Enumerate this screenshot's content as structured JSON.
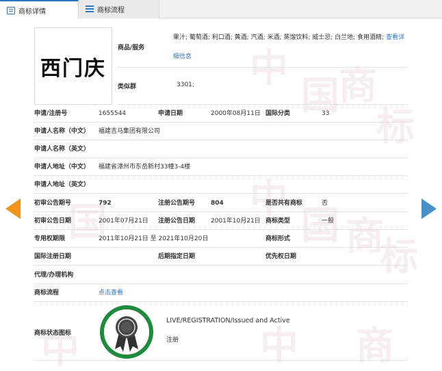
{
  "tabs": [
    {
      "label": "商标详情",
      "icon": "document-icon",
      "active": true
    },
    {
      "label": "商标流程",
      "icon": "list-icon",
      "active": false
    }
  ],
  "trademark": {
    "logo_text": "西门庆",
    "goods_label": "商品/服务",
    "goods_value": "果汁; 葡萄酒; 利口酒; 黄酒; 汽酒; 米酒; 蒸馏饮料; 威士忌; 白兰地; 食用酒精;",
    "goods_more_line1": "查看详",
    "goods_more_line2": "细信息",
    "similar_group_label": "类似群",
    "similar_group_value": "3301;",
    "reg_no_label": "申请/注册号",
    "reg_no_value": "1655544",
    "apply_date_label": "申请日期",
    "apply_date_value": "2000年08月11日",
    "intl_class_label": "国际分类",
    "intl_class_value": "33",
    "applicant_cn_label": "申请人名称（中文）",
    "applicant_cn_value": "福建吉马集团有限公司",
    "applicant_en_label": "申请人名称（英文）",
    "address_cn_label": "申请人地址（中文）",
    "address_cn_value": "福建省漳州市东岳新村33幢3-4楼",
    "address_en_label": "申请人地址（英文）",
    "prelim_no_label": "初审公告期号",
    "prelim_no_value": "792",
    "reg_pub_no_label": "注册公告期号",
    "reg_pub_no_value": "804",
    "shared_label": "是否共有商标",
    "shared_value": "否",
    "prelim_date_label": "初审公告日期",
    "prelim_date_value": "2001年07月21日",
    "reg_pub_date_label": "注册公告日期",
    "reg_pub_date_value": "2001年10月21日",
    "tm_type_label": "商标类型",
    "tm_type_value": "一般",
    "exclusive_label": "专用权期限",
    "exclusive_value": "2011年10月21日 至 2021年10月20日",
    "tm_form_label": "商标形式",
    "intl_reg_date_label": "国际注册日期",
    "later_date_label": "后期指定日期",
    "priority_date_label": "优先权日期",
    "agent_label": "代理/办理机构",
    "flow_label": "商标流程",
    "flow_link": "点击查看",
    "status_icon_label": "商标状态图标",
    "status_en": "LIVE/REGISTRATION/Issued and Active",
    "status_cn": "注册"
  },
  "watermark": [
    "中",
    "国",
    "商",
    "标"
  ],
  "colors": {
    "accent": "#2f76c5",
    "badge_green": "#1e8a3c",
    "arrow_left": "#f2931a",
    "arrow_right": "#4a90c8"
  }
}
